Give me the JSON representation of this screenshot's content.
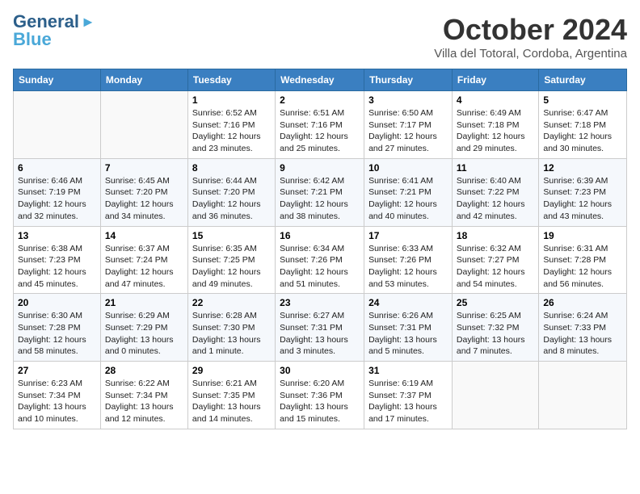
{
  "header": {
    "logo_general": "General",
    "logo_blue": "Blue",
    "month_title": "October 2024",
    "location": "Villa del Totoral, Cordoba, Argentina"
  },
  "days_of_week": [
    "Sunday",
    "Monday",
    "Tuesday",
    "Wednesday",
    "Thursday",
    "Friday",
    "Saturday"
  ],
  "weeks": [
    [
      {
        "num": "",
        "info": ""
      },
      {
        "num": "",
        "info": ""
      },
      {
        "num": "1",
        "info": "Sunrise: 6:52 AM\nSunset: 7:16 PM\nDaylight: 12 hours and 23 minutes."
      },
      {
        "num": "2",
        "info": "Sunrise: 6:51 AM\nSunset: 7:16 PM\nDaylight: 12 hours and 25 minutes."
      },
      {
        "num": "3",
        "info": "Sunrise: 6:50 AM\nSunset: 7:17 PM\nDaylight: 12 hours and 27 minutes."
      },
      {
        "num": "4",
        "info": "Sunrise: 6:49 AM\nSunset: 7:18 PM\nDaylight: 12 hours and 29 minutes."
      },
      {
        "num": "5",
        "info": "Sunrise: 6:47 AM\nSunset: 7:18 PM\nDaylight: 12 hours and 30 minutes."
      }
    ],
    [
      {
        "num": "6",
        "info": "Sunrise: 6:46 AM\nSunset: 7:19 PM\nDaylight: 12 hours and 32 minutes."
      },
      {
        "num": "7",
        "info": "Sunrise: 6:45 AM\nSunset: 7:20 PM\nDaylight: 12 hours and 34 minutes."
      },
      {
        "num": "8",
        "info": "Sunrise: 6:44 AM\nSunset: 7:20 PM\nDaylight: 12 hours and 36 minutes."
      },
      {
        "num": "9",
        "info": "Sunrise: 6:42 AM\nSunset: 7:21 PM\nDaylight: 12 hours and 38 minutes."
      },
      {
        "num": "10",
        "info": "Sunrise: 6:41 AM\nSunset: 7:21 PM\nDaylight: 12 hours and 40 minutes."
      },
      {
        "num": "11",
        "info": "Sunrise: 6:40 AM\nSunset: 7:22 PM\nDaylight: 12 hours and 42 minutes."
      },
      {
        "num": "12",
        "info": "Sunrise: 6:39 AM\nSunset: 7:23 PM\nDaylight: 12 hours and 43 minutes."
      }
    ],
    [
      {
        "num": "13",
        "info": "Sunrise: 6:38 AM\nSunset: 7:23 PM\nDaylight: 12 hours and 45 minutes."
      },
      {
        "num": "14",
        "info": "Sunrise: 6:37 AM\nSunset: 7:24 PM\nDaylight: 12 hours and 47 minutes."
      },
      {
        "num": "15",
        "info": "Sunrise: 6:35 AM\nSunset: 7:25 PM\nDaylight: 12 hours and 49 minutes."
      },
      {
        "num": "16",
        "info": "Sunrise: 6:34 AM\nSunset: 7:26 PM\nDaylight: 12 hours and 51 minutes."
      },
      {
        "num": "17",
        "info": "Sunrise: 6:33 AM\nSunset: 7:26 PM\nDaylight: 12 hours and 53 minutes."
      },
      {
        "num": "18",
        "info": "Sunrise: 6:32 AM\nSunset: 7:27 PM\nDaylight: 12 hours and 54 minutes."
      },
      {
        "num": "19",
        "info": "Sunrise: 6:31 AM\nSunset: 7:28 PM\nDaylight: 12 hours and 56 minutes."
      }
    ],
    [
      {
        "num": "20",
        "info": "Sunrise: 6:30 AM\nSunset: 7:28 PM\nDaylight: 12 hours and 58 minutes."
      },
      {
        "num": "21",
        "info": "Sunrise: 6:29 AM\nSunset: 7:29 PM\nDaylight: 13 hours and 0 minutes."
      },
      {
        "num": "22",
        "info": "Sunrise: 6:28 AM\nSunset: 7:30 PM\nDaylight: 13 hours and 1 minute."
      },
      {
        "num": "23",
        "info": "Sunrise: 6:27 AM\nSunset: 7:31 PM\nDaylight: 13 hours and 3 minutes."
      },
      {
        "num": "24",
        "info": "Sunrise: 6:26 AM\nSunset: 7:31 PM\nDaylight: 13 hours and 5 minutes."
      },
      {
        "num": "25",
        "info": "Sunrise: 6:25 AM\nSunset: 7:32 PM\nDaylight: 13 hours and 7 minutes."
      },
      {
        "num": "26",
        "info": "Sunrise: 6:24 AM\nSunset: 7:33 PM\nDaylight: 13 hours and 8 minutes."
      }
    ],
    [
      {
        "num": "27",
        "info": "Sunrise: 6:23 AM\nSunset: 7:34 PM\nDaylight: 13 hours and 10 minutes."
      },
      {
        "num": "28",
        "info": "Sunrise: 6:22 AM\nSunset: 7:34 PM\nDaylight: 13 hours and 12 minutes."
      },
      {
        "num": "29",
        "info": "Sunrise: 6:21 AM\nSunset: 7:35 PM\nDaylight: 13 hours and 14 minutes."
      },
      {
        "num": "30",
        "info": "Sunrise: 6:20 AM\nSunset: 7:36 PM\nDaylight: 13 hours and 15 minutes."
      },
      {
        "num": "31",
        "info": "Sunrise: 6:19 AM\nSunset: 7:37 PM\nDaylight: 13 hours and 17 minutes."
      },
      {
        "num": "",
        "info": ""
      },
      {
        "num": "",
        "info": ""
      }
    ]
  ]
}
